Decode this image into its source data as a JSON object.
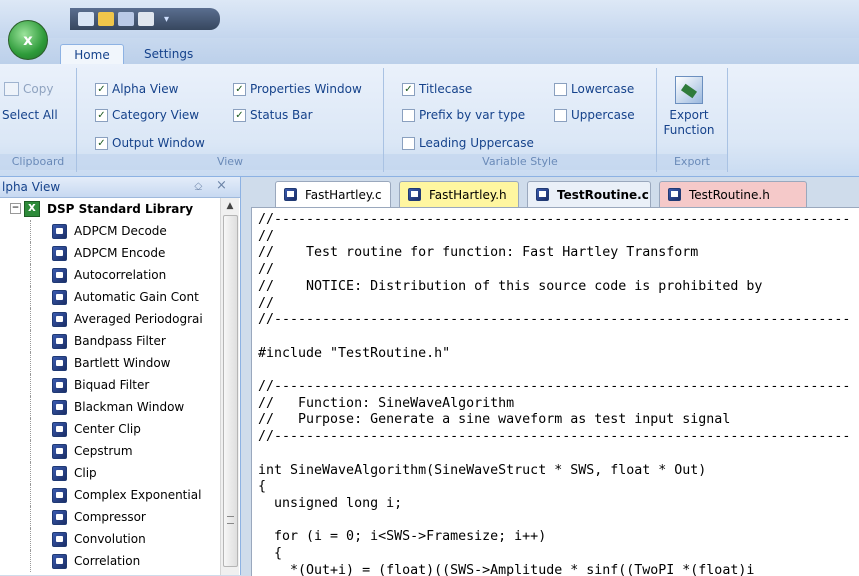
{
  "ribbon": {
    "tabs": [
      "Home",
      "Settings"
    ],
    "clipboard": {
      "title": "Clipboard",
      "copy": "Copy",
      "select_all": "Select All"
    },
    "view": {
      "title": "View",
      "alpha_view": "Alpha View",
      "category_view": "Category View",
      "output_window": "Output Window",
      "properties_window": "Properties Window",
      "status_bar": "Status Bar"
    },
    "variable_style": {
      "title": "Variable Style",
      "titlecase": "Titlecase",
      "prefix_by_var_type": "Prefix by var type",
      "leading_uppercase": "Leading Uppercase",
      "lowercase": "Lowercase",
      "uppercase": "Uppercase"
    },
    "export": {
      "title": "Export",
      "button_line1": "Export",
      "button_line2": "Function"
    }
  },
  "left_panel": {
    "title": "lpha View",
    "pin": "⎐",
    "close": "×",
    "root": "DSP Standard Library",
    "items": [
      "ADPCM Decode",
      "ADPCM Encode",
      "Autocorrelation",
      "Automatic Gain Cont",
      "Averaged Periodograi",
      "Bandpass Filter",
      "Bartlett Window",
      "Biquad Filter",
      "Blackman Window",
      "Center Clip",
      "Cepstrum",
      "Clip",
      "Complex Exponential",
      "Compressor",
      "Convolution",
      "Correlation"
    ]
  },
  "editor": {
    "tabs": [
      {
        "label": "FastHartley.c",
        "color": "#ffffff"
      },
      {
        "label": "FastHartley.h",
        "color": "#fff6a0"
      },
      {
        "label": "TestRoutine.c",
        "color": "#eaf0f8"
      },
      {
        "label": "TestRoutine.h",
        "color": "#f5c9c9"
      }
    ],
    "code": "//------------------------------------------------------------------------\n//\n//    Test routine for function: Fast Hartley Transform\n//\n//    NOTICE: Distribution of this source code is prohibited by\n//\n//------------------------------------------------------------------------\n\n#include \"TestRoutine.h\"\n\n//------------------------------------------------------------------------\n//   Function: SineWaveAlgorithm\n//   Purpose: Generate a sine waveform as test input signal\n//------------------------------------------------------------------------\n\nint SineWaveAlgorithm(SineWaveStruct * SWS, float * Out)\n{\n  unsigned long i;\n\n  for (i = 0; i<SWS->Framesize; i++)\n  {\n    *(Out+i) = (float)((SWS->Amplitude * sinf((TwoPI *(float)i\n  }"
  }
}
